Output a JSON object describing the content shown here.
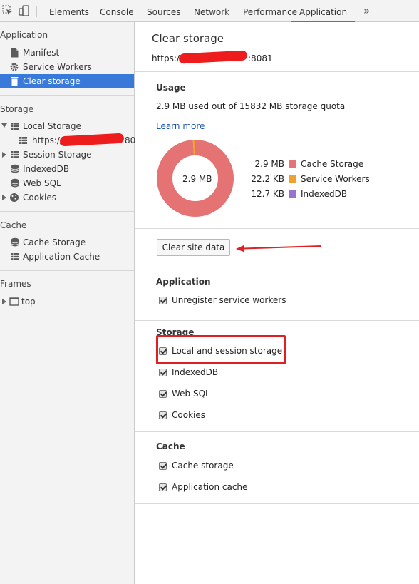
{
  "toolbar": {
    "tabs": [
      "Elements",
      "Console",
      "Sources",
      "Network",
      "Performance",
      "Application"
    ],
    "active_tab": "Application",
    "more_icon": "chevron-double-right-icon"
  },
  "sidebar": {
    "sections": {
      "application": "Application",
      "storage": "Storage",
      "cache": "Cache",
      "frames": "Frames"
    },
    "items": {
      "manifest": "Manifest",
      "service_workers": "Service Workers",
      "clear_storage": "Clear storage",
      "local_storage": "Local Storage",
      "local_storage_origin": "https://",
      "local_storage_origin_tail": "80",
      "session_storage": "Session Storage",
      "indexeddb": "IndexedDB",
      "web_sql": "Web SQL",
      "cookies": "Cookies",
      "cache_storage": "Cache Storage",
      "application_cache": "Application Cache",
      "top": "top"
    },
    "selected": "Clear storage"
  },
  "main": {
    "title": "Clear storage",
    "origin_prefix": "https://",
    "origin_suffix": ":8081",
    "usage": {
      "heading": "Usage",
      "summary": "2.9 MB used out of 15832 MB storage quota",
      "learn_more": "Learn more",
      "donut_center": "2.9 MB",
      "legend": [
        {
          "value": "2.9 MB",
          "name": "Cache Storage",
          "color": "#e57373"
        },
        {
          "value": "22.2 KB",
          "name": "Service Workers",
          "color": "#f0a030"
        },
        {
          "value": "12.7 KB",
          "name": "IndexedDB",
          "color": "#9575cd"
        }
      ]
    },
    "clear_button": "Clear site data",
    "application": {
      "heading": "Application",
      "options": [
        "Unregister service workers"
      ]
    },
    "storage": {
      "heading": "Storage",
      "options": [
        "Local and session storage",
        "IndexedDB",
        "Web SQL",
        "Cookies"
      ]
    },
    "cache": {
      "heading": "Cache",
      "options": [
        "Cache storage",
        "Application cache"
      ]
    }
  },
  "colors": {
    "accent": "#3879d9",
    "annotation": "#e02020"
  }
}
